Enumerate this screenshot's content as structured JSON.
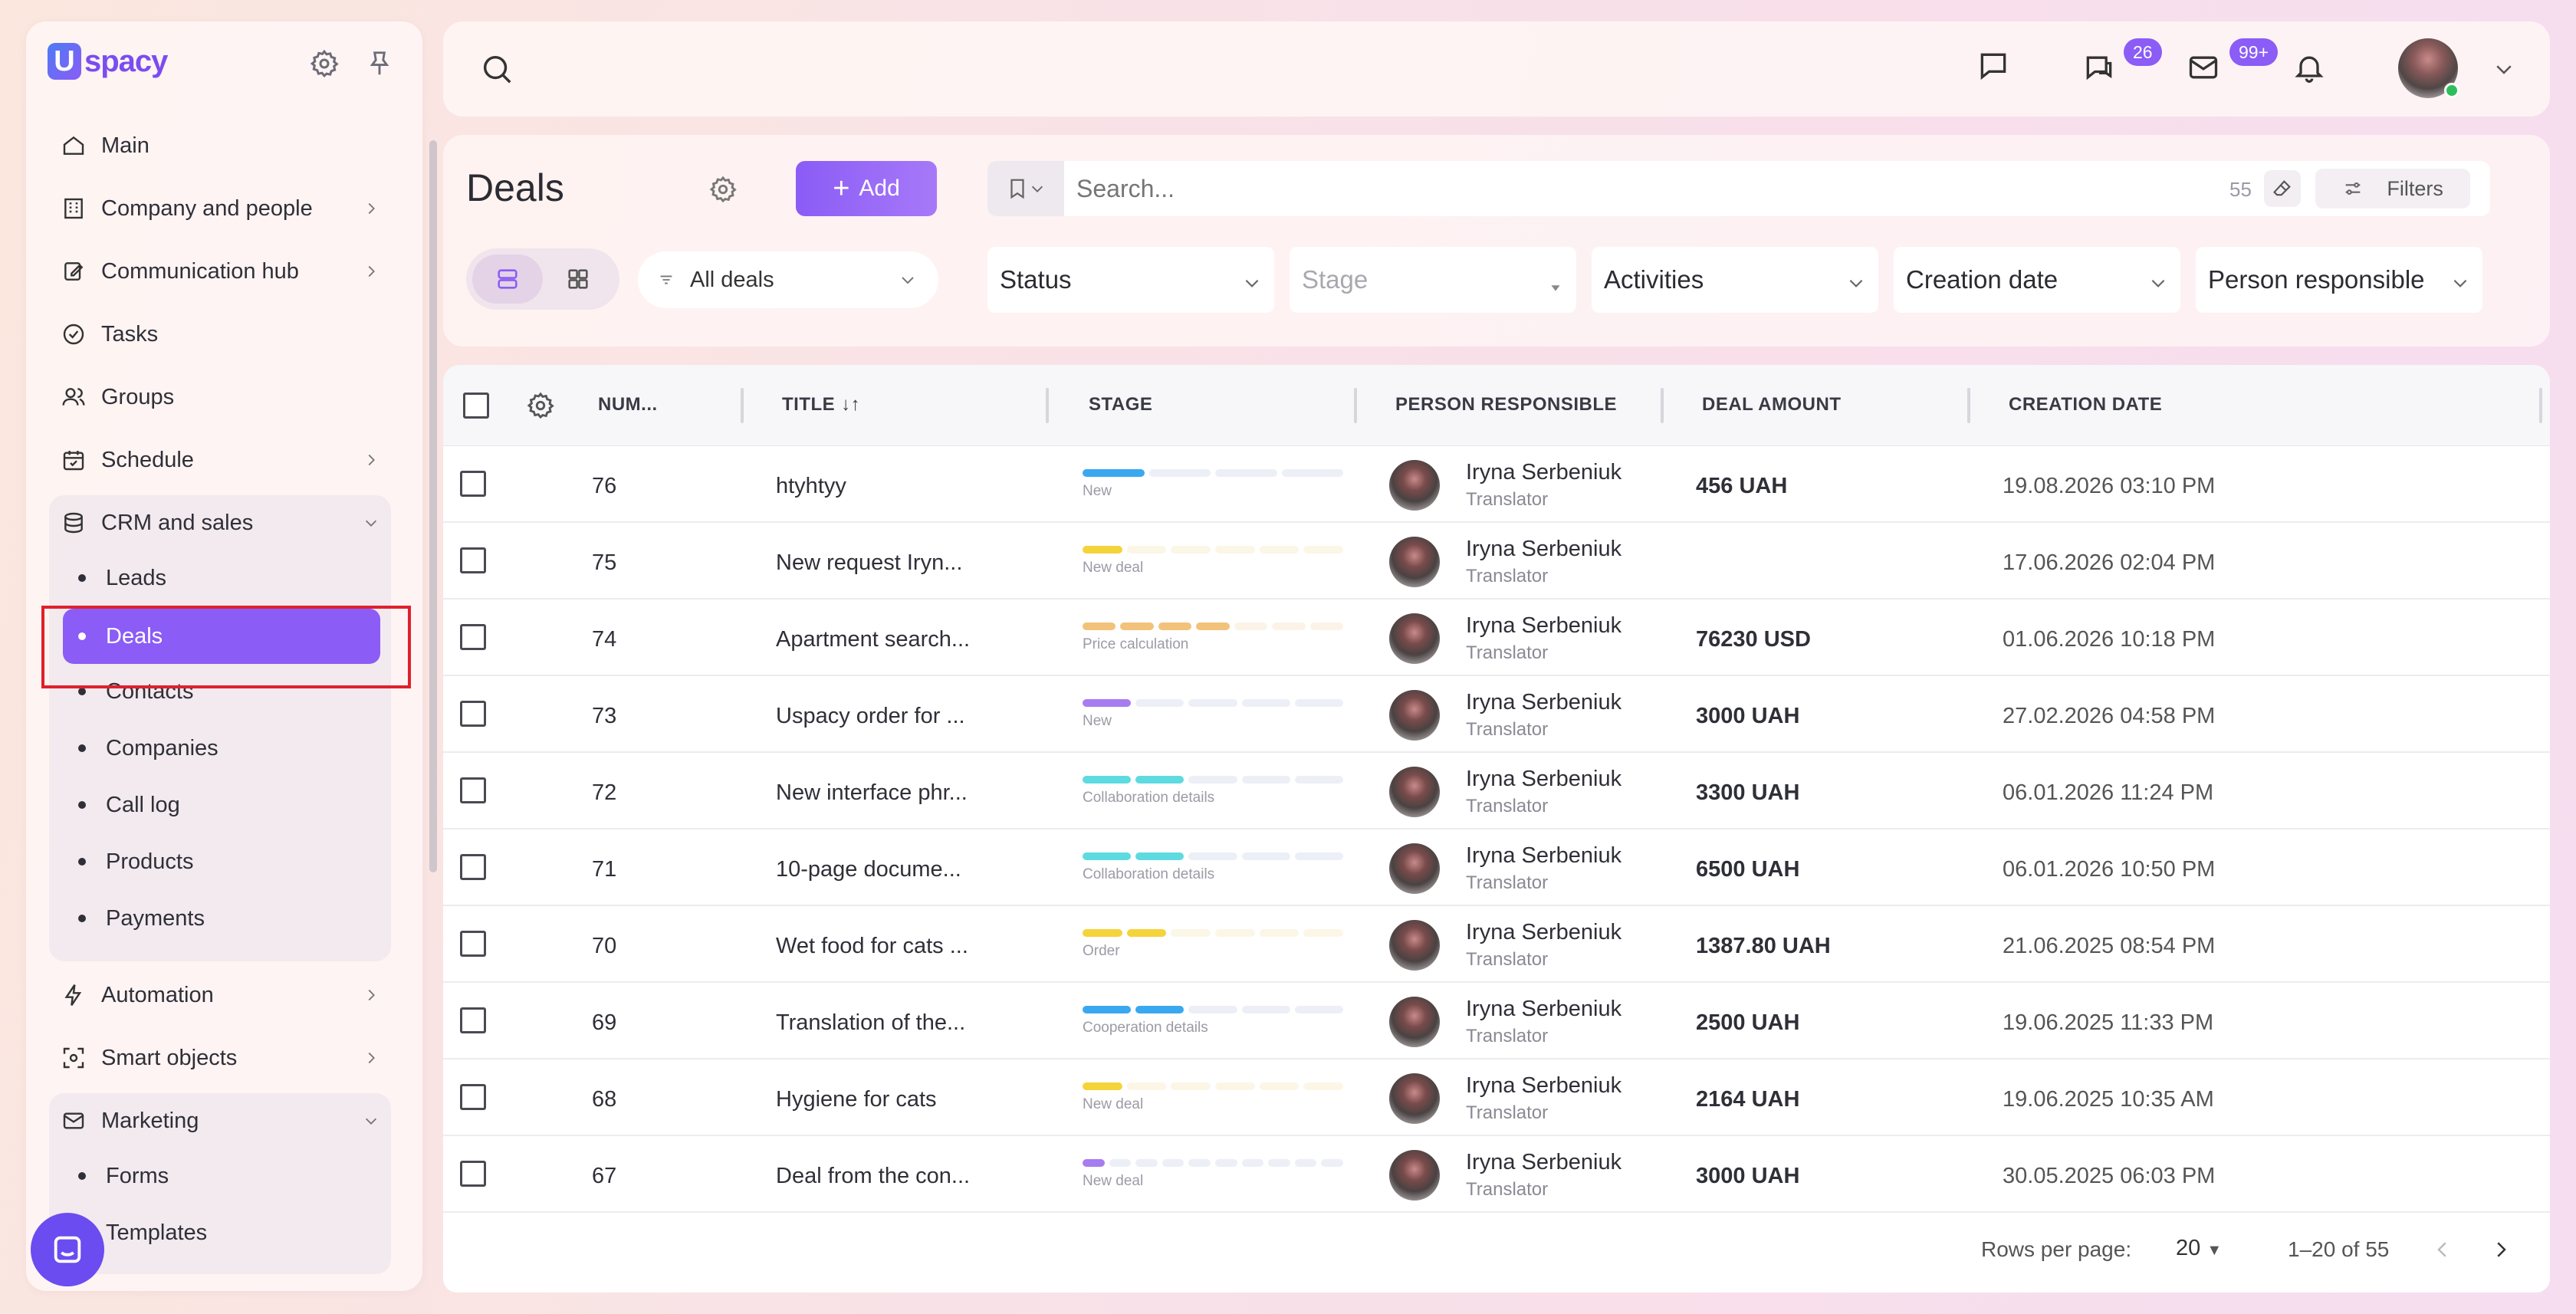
{
  "app": {
    "logo_mark": "U",
    "logo_text": "spacy"
  },
  "sidebar": {
    "items": [
      {
        "label": "Main",
        "icon": "home-icon"
      },
      {
        "label": "Company and people",
        "icon": "building-icon"
      },
      {
        "label": "Communication hub",
        "icon": "edit-icon"
      },
      {
        "label": "Tasks",
        "icon": "check-circle-icon"
      },
      {
        "label": "Groups",
        "icon": "users-icon"
      },
      {
        "label": "Schedule",
        "icon": "calendar-icon"
      },
      {
        "label": "CRM and sales",
        "icon": "database-icon"
      },
      {
        "label": "Automation",
        "icon": "lightning-icon"
      },
      {
        "label": "Smart objects",
        "icon": "scan-icon"
      },
      {
        "label": "Marketing",
        "icon": "mail-icon"
      }
    ],
    "crm_sub": [
      "Leads",
      "Deals",
      "Contacts",
      "Companies",
      "Call log",
      "Products",
      "Payments"
    ],
    "marketing_sub": [
      "Forms",
      "Templates"
    ]
  },
  "header": {
    "chat_badge": "26",
    "mail_badge": "99+"
  },
  "toolbar": {
    "title": "Deals",
    "add_label": "Add",
    "search_placeholder": "Search...",
    "search_count": "55",
    "filters_label": "Filters",
    "view_filter": "All deals",
    "filters": {
      "status": "Status",
      "stage": "Stage",
      "activities": "Activities",
      "creation_date": "Creation date",
      "person": "Person responsible"
    }
  },
  "table": {
    "columns": {
      "number": "NUM...",
      "title": "TITLE",
      "stage": "STAGE",
      "person": "PERSON RESPONSIBLE",
      "amount": "DEAL AMOUNT",
      "date": "CREATION DATE"
    },
    "rows": [
      {
        "number": "76",
        "title": "htyhtyy",
        "stage": "New",
        "stage_color": "#3aa8f0",
        "filled": 1,
        "total": 4,
        "person": "Iryna Serbeniuk",
        "role": "Translator",
        "amount": "456 UAH",
        "date": "19.08.2026 03:10 PM"
      },
      {
        "number": "75",
        "title": "New request Iryn...",
        "stage": "New deal",
        "stage_color": "#f5d33a",
        "filled": 1,
        "total": 6,
        "person": "Iryna Serbeniuk",
        "role": "Translator",
        "amount": "",
        "date": "17.06.2026 02:04 PM"
      },
      {
        "number": "74",
        "title": "Apartment search...",
        "stage": "Price calculation",
        "stage_color": "#f2c27a",
        "filled": 4,
        "total": 7,
        "person": "Iryna Serbeniuk",
        "role": "Translator",
        "amount": "76230 USD",
        "date": "01.06.2026 10:18 PM"
      },
      {
        "number": "73",
        "title": "Uspacy order for ...",
        "stage": "New",
        "stage_color": "#a77cf0",
        "filled": 1,
        "total": 5,
        "person": "Iryna Serbeniuk",
        "role": "Translator",
        "amount": "3000 UAH",
        "date": "27.02.2026 04:58 PM"
      },
      {
        "number": "72",
        "title": "New interface phr...",
        "stage": "Collaboration details",
        "stage_color": "#5edbe0",
        "filled": 2,
        "total": 5,
        "person": "Iryna Serbeniuk",
        "role": "Translator",
        "amount": "3300 UAH",
        "date": "06.01.2026 11:24 PM"
      },
      {
        "number": "71",
        "title": "10-page docume...",
        "stage": "Collaboration details",
        "stage_color": "#5edbe0",
        "filled": 2,
        "total": 5,
        "person": "Iryna Serbeniuk",
        "role": "Translator",
        "amount": "6500 UAH",
        "date": "06.01.2026 10:50 PM"
      },
      {
        "number": "70",
        "title": "Wet food for cats ...",
        "stage": "Order",
        "stage_color": "#f5d33a",
        "filled": 2,
        "total": 6,
        "person": "Iryna Serbeniuk",
        "role": "Translator",
        "amount": "1387.80 UAH",
        "date": "21.06.2025 08:54 PM"
      },
      {
        "number": "69",
        "title": "Translation of the...",
        "stage": "Cooperation details",
        "stage_color": "#3aa8f0",
        "filled": 2,
        "total": 5,
        "person": "Iryna Serbeniuk",
        "role": "Translator",
        "amount": "2500 UAH",
        "date": "19.06.2025 11:33 PM"
      },
      {
        "number": "68",
        "title": "Hygiene for cats",
        "stage": "New deal",
        "stage_color": "#f5d33a",
        "filled": 1,
        "total": 6,
        "person": "Iryna Serbeniuk",
        "role": "Translator",
        "amount": "2164 UAH",
        "date": "19.06.2025 10:35 AM"
      },
      {
        "number": "67",
        "title": "Deal from the con...",
        "stage": "New deal",
        "stage_color": "#a77cf0",
        "filled": 1,
        "total": 10,
        "person": "Iryna Serbeniuk",
        "role": "Translator",
        "amount": "3000 UAH",
        "date": "30.05.2025 06:03 PM"
      }
    ]
  },
  "footer": {
    "rows_per_page_label": "Rows per page:",
    "rows_per_page": "20",
    "range": "1–20 of 55"
  },
  "colors": {
    "accent": "#8b5cf6",
    "highlight": "#e0202d",
    "online": "#2fbf5a"
  }
}
